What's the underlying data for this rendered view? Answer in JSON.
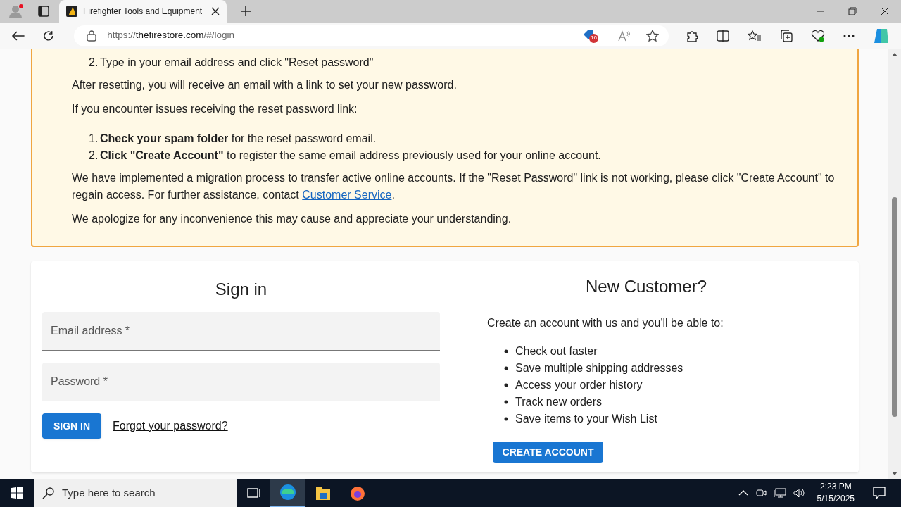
{
  "browser": {
    "tabs": [
      {
        "title": "Firefighter Tools and Equipment",
        "selected": true
      }
    ],
    "url_scheme": "https://",
    "url_host": "thefirestore.com",
    "url_path": "/#/login",
    "shopping_badge": "16"
  },
  "notice": {
    "steps_top": [
      {
        "number": "2.",
        "text": "Type in your email address and click \"Reset password\""
      }
    ],
    "after_reset": "After resetting, you will receive an email with a link to set your new password.",
    "issues_intro": "If you encounter issues receiving the reset password link:",
    "issue_steps": [
      {
        "number": "1.",
        "text": "**Check your spam folder** for the reset password email."
      },
      {
        "number": "2.",
        "text": "**Click \"Create Account\"** to register the same email address previously used for your online account."
      }
    ],
    "migration_text": "We have implemented a migration process to transfer active online accounts. If the \"Reset Password\" link is not working, please click \"Create Account\" to regain access. For further assistance, contact ",
    "migration_link": "Customer Service",
    "migration_end": ".",
    "apology": "We apologize for any inconvenience this may cause and appreciate your understanding."
  },
  "sign_in": {
    "title": "Sign in",
    "fields": [
      {
        "label": "Email address *"
      },
      {
        "label": "Password *"
      }
    ],
    "button": "SIGN IN",
    "forgot_link": "Forgot your password?"
  },
  "new_customer": {
    "title": "New Customer?",
    "intro": "Create an account with us and you'll be able to:",
    "benefits": [
      "Check out faster",
      "Save multiple shipping addresses",
      "Access your order history",
      "Track new orders",
      "Save items to your Wish List"
    ],
    "button": "CREATE ACCOUNT"
  },
  "taskbar": {
    "search_placeholder": "Type here to search",
    "time": "2:23 PM",
    "date": "5/15/2025"
  }
}
